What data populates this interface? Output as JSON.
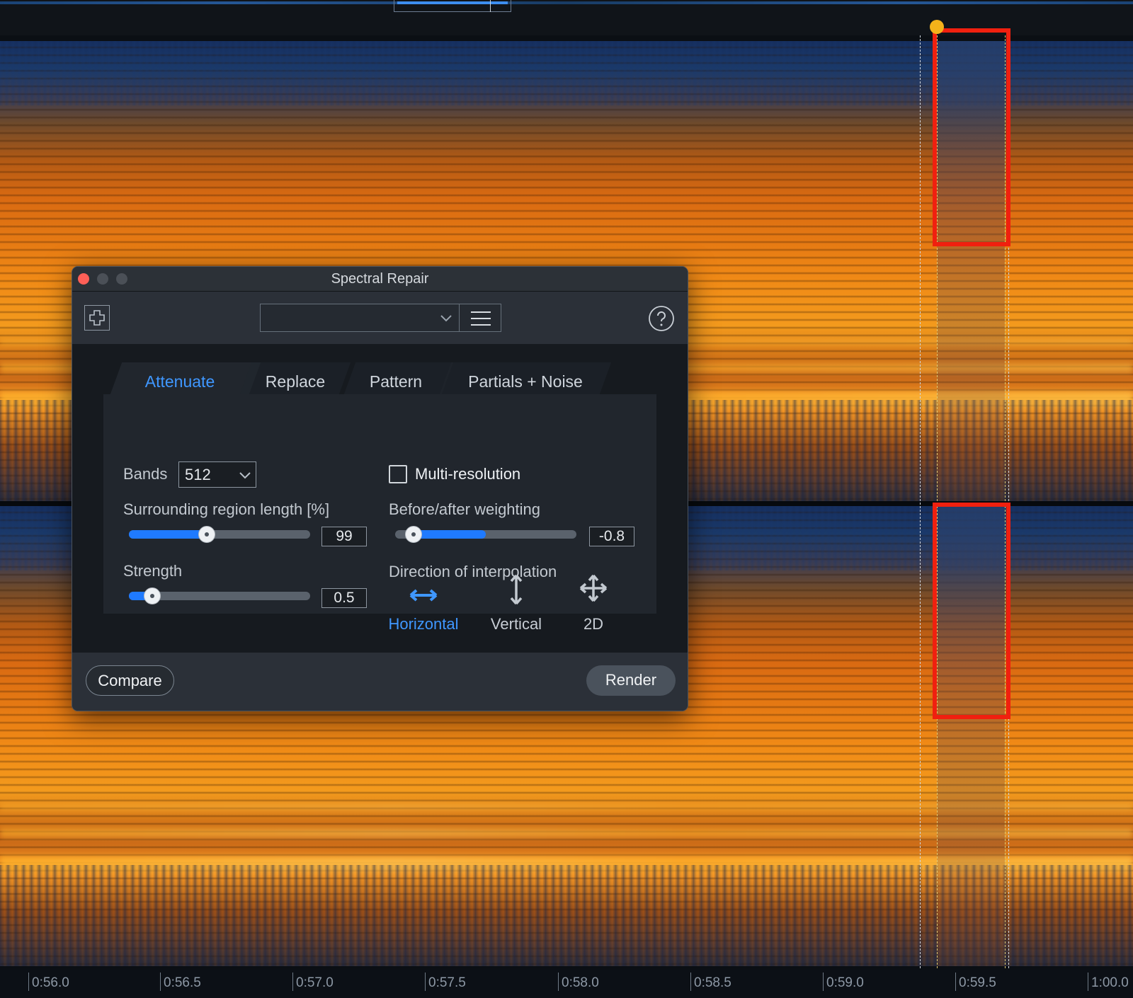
{
  "dialog": {
    "title": "Spectral Repair",
    "tabs": [
      {
        "label": "Attenuate",
        "active": true
      },
      {
        "label": "Replace",
        "active": false
      },
      {
        "label": "Pattern",
        "active": false
      },
      {
        "label": "Partials + Noise",
        "active": false
      }
    ],
    "bands": {
      "label": "Bands",
      "value": "512"
    },
    "multi_resolution": {
      "label": "Multi-resolution",
      "checked": false
    },
    "surrounding_region": {
      "label": "Surrounding region length [%]",
      "value": "99",
      "fraction": 0.43
    },
    "before_after": {
      "label": "Before/after weighting",
      "value": "-0.8",
      "fraction": 0.1
    },
    "strength": {
      "label": "Strength",
      "value": "0.5",
      "fraction": 0.13
    },
    "direction": {
      "label": "Direction of interpolation",
      "options": [
        {
          "label": "Horizontal",
          "icon": "horizontal-arrows-icon",
          "active": true
        },
        {
          "label": "Vertical",
          "icon": "vertical-arrows-icon",
          "active": false
        },
        {
          "label": "2D",
          "icon": "move-arrows-icon",
          "active": false
        }
      ]
    },
    "compare_label": "Compare",
    "render_label": "Render",
    "accent_color": "#3f97ff"
  },
  "timeline": {
    "ticks": [
      "0:56.0",
      "0:56.5",
      "0:57.0",
      "0:57.5",
      "0:58.0",
      "0:58.5",
      "0:59.0",
      "0:59.5",
      "1:00.0"
    ]
  },
  "highlight_color": "#f0200f"
}
